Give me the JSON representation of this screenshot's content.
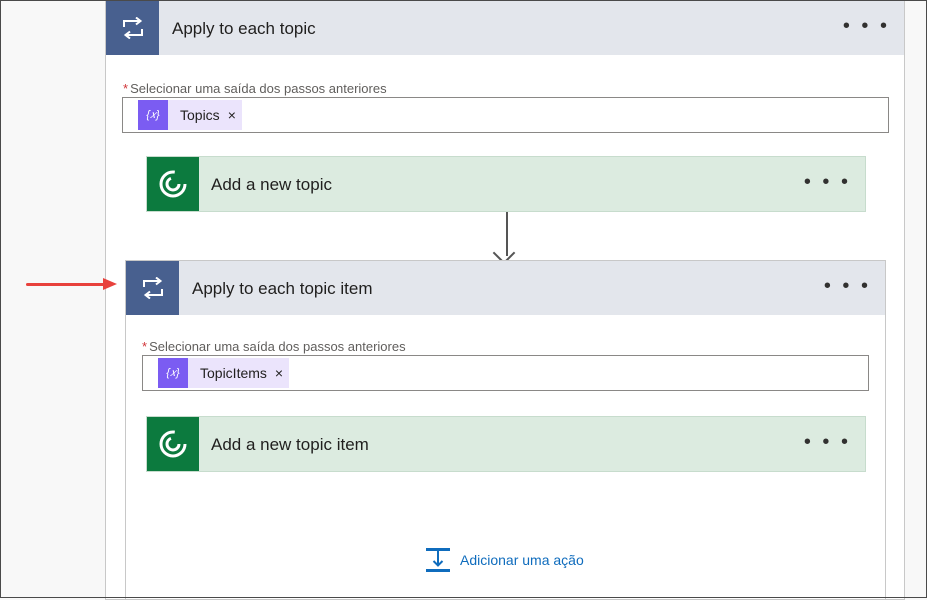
{
  "outer_scope": {
    "title": "Apply to each topic",
    "more_label": "• • •",
    "field": {
      "required_mark": "*",
      "label": "Selecionar uma saída dos passos anteriores",
      "token_label": "Topics",
      "token_icon": "{𝑥}",
      "remove_label": "×"
    },
    "action": {
      "title": "Add a new topic",
      "more_label": "• • •"
    }
  },
  "inner_scope": {
    "title": "Apply to each topic item",
    "more_label": "• • •",
    "field": {
      "required_mark": "*",
      "label": "Selecionar uma saída dos passos anteriores",
      "token_label": "TopicItems",
      "token_icon": "{𝑥}",
      "remove_label": "×"
    },
    "action": {
      "title": "Add a new topic item",
      "more_label": "• • •"
    },
    "add_action_label": "Adicionar uma ação"
  },
  "colors": {
    "scope_header_bg": "#e3e6ec",
    "scope_icon_bg": "#48608f",
    "dataverse_green": "#0c7a3e",
    "action_card_bg": "#dcebe0",
    "token_purple": "#7b5cf2",
    "annotation_red": "#e8413c",
    "link_blue": "#0f6cbd"
  },
  "icons": {
    "scope": "loop-icon",
    "action": "dataverse-icon",
    "token": "expression-icon",
    "add": "add-action-icon",
    "annotation": "red-arrow-icon"
  }
}
